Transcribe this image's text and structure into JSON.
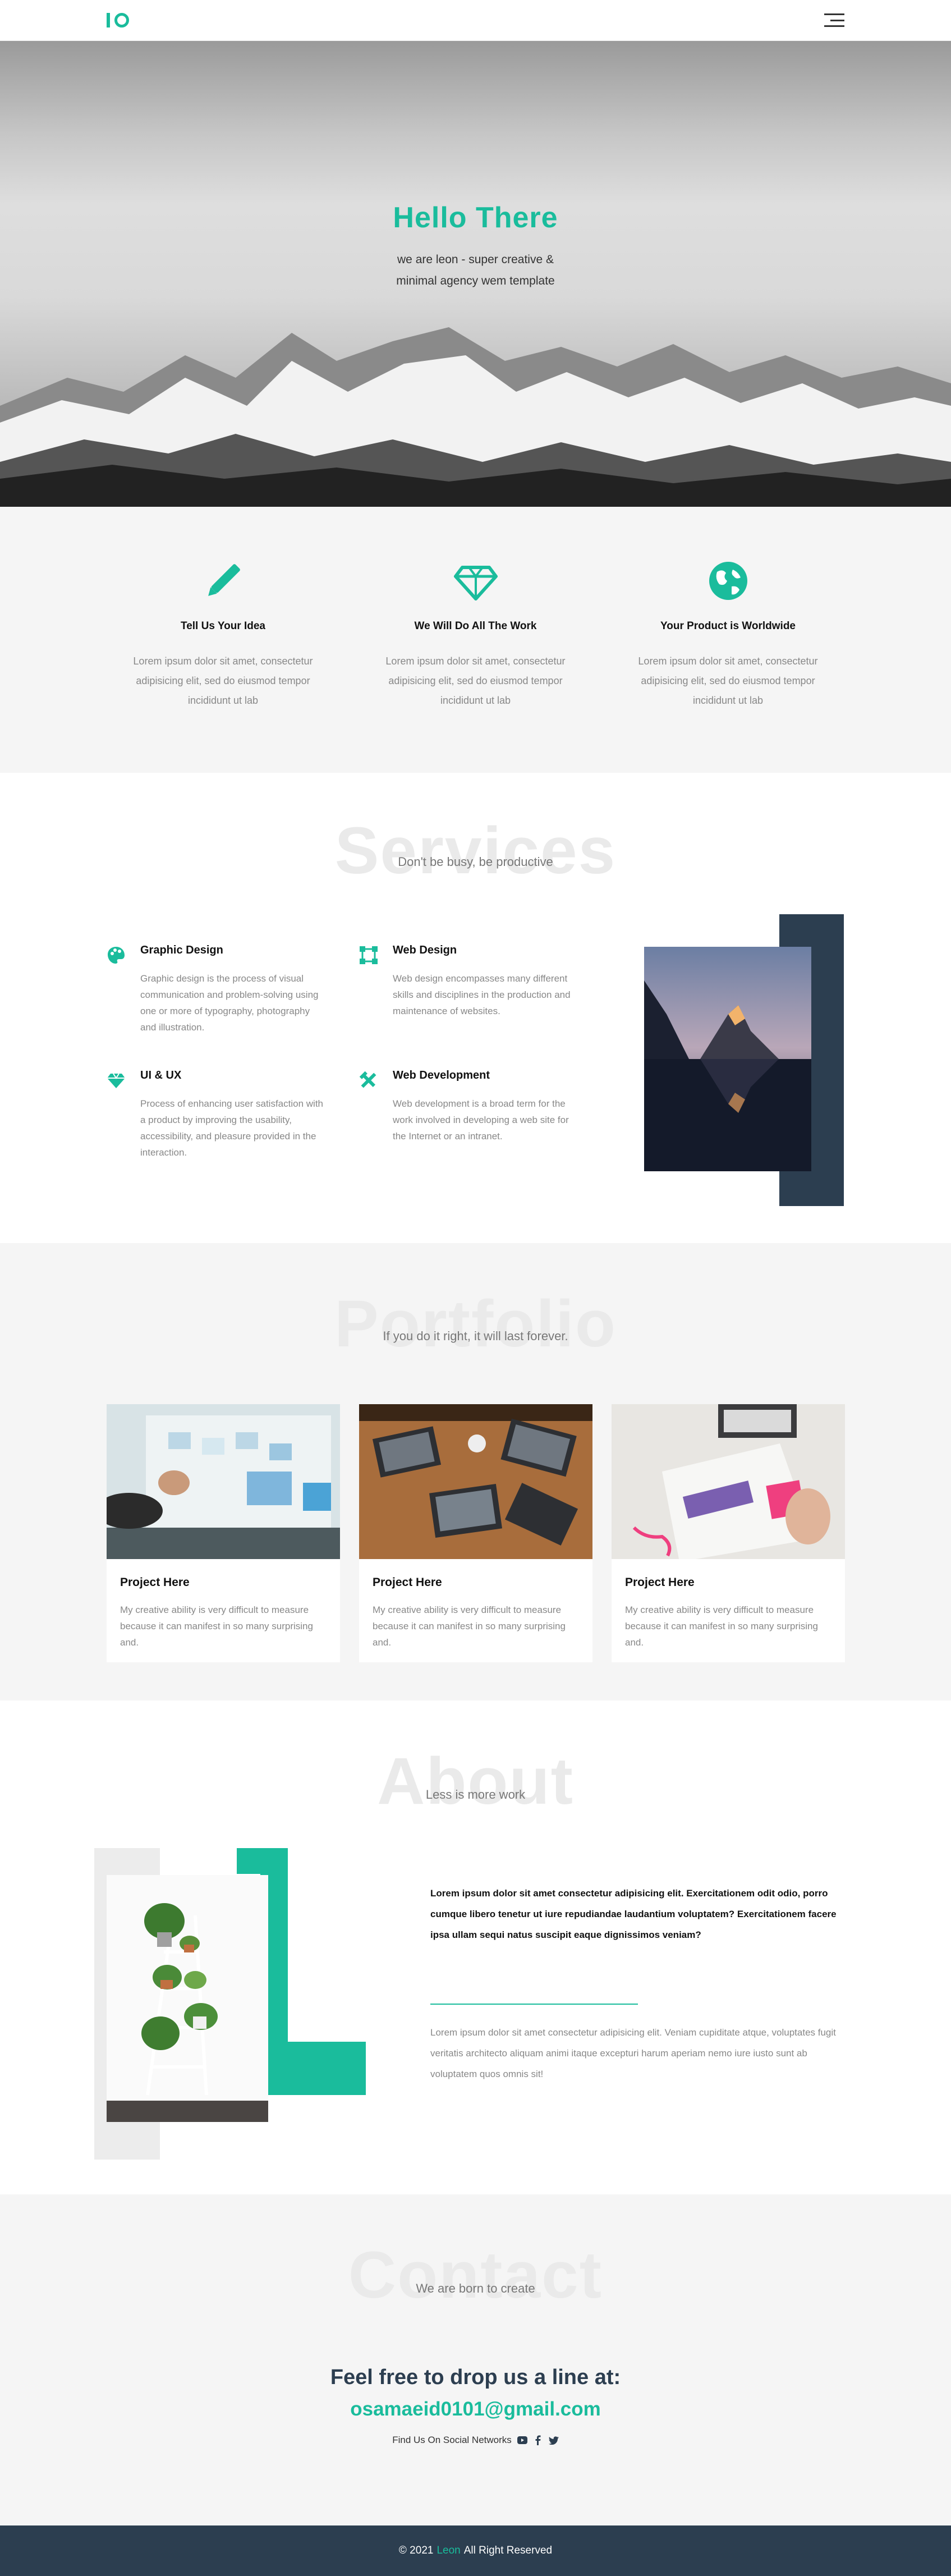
{
  "nav": {
    "logo_alt": "leon logo",
    "menu_icon": "hamburger-icon"
  },
  "hero": {
    "title": "Hello There",
    "subtitle": "we are leon - super creative & minimal agency wem template"
  },
  "features": [
    {
      "icon": "pencil-icon",
      "title": "Tell Us Your Idea",
      "text": "Lorem ipsum dolor sit amet, consectetur adipisicing elit, sed do eiusmod tempor incididunt ut lab"
    },
    {
      "icon": "diamond-icon",
      "title": "We Will Do All The Work",
      "text": "Lorem ipsum dolor sit amet, consectetur adipisicing elit, sed do eiusmod tempor incididunt ut lab"
    },
    {
      "icon": "globe-icon",
      "title": "Your Product is Worldwide",
      "text": "Lorem ipsum dolor sit amet, consectetur adipisicing elit, sed do eiusmod tempor incididunt ut lab"
    }
  ],
  "services": {
    "heading": "Services",
    "tagline": "Don't be busy, be productive",
    "items": [
      {
        "icon": "palette-icon",
        "title": "Graphic Design",
        "text": "Graphic design is the process of visual communication and problem-solving using one or more of typography, photography and illustration."
      },
      {
        "icon": "vector-square-icon",
        "title": "Web Design",
        "text": "Web design encompasses many different skills and disciplines in the production and maintenance of websites."
      },
      {
        "icon": "gem-icon",
        "title": "UI & UX",
        "text": "Process of enhancing user satisfaction with a product by improving the usability, accessibility, and pleasure provided in the interaction."
      },
      {
        "icon": "tools-icon",
        "title": "Web Development",
        "text": "Web development is a broad term for the work involved in developing a web site for the Internet or an intranet."
      }
    ]
  },
  "portfolio": {
    "heading": "Portfolio",
    "tagline": "If you do it right, it will last forever.",
    "cards": [
      {
        "title": "Project Here",
        "text": "My creative ability is very difficult to measure because it can manifest in so many surprising and."
      },
      {
        "title": "Project Here",
        "text": "My creative ability is very difficult to measure because it can manifest in so many surprising and."
      },
      {
        "title": "Project Here",
        "text": "My creative ability is very difficult to measure because it can manifest in so many surprising and."
      }
    ]
  },
  "about": {
    "heading": "About",
    "tagline": "Less is more work",
    "bold_text": "Lorem ipsum dolor sit amet consectetur adipisicing elit. Exercitationem odit odio, porro cumque libero tenetur ut iure repudiandae laudantium voluptatem? Exercitationem facere ipsa ullam sequi natus suscipit eaque dignissimos veniam?",
    "text": "Lorem ipsum dolor sit amet consectetur adipisicing elit. Veniam cupiditate atque, voluptates fugit veritatis architecto aliquam animi itaque excepturi harum aperiam nemo iure iusto sunt ab voluptatem quos omnis sit!"
  },
  "contact": {
    "heading": "Contact",
    "tagline": "We are born to create",
    "line": "Feel free to drop us a line at:",
    "email": "osamaeid0101@gmail.com",
    "social_label": "Find Us On Social Networks",
    "social_icons": [
      "youtube-icon",
      "facebook-icon",
      "twitter-icon"
    ]
  },
  "footer": {
    "prefix": "© 2021",
    "brand": "Leon",
    "suffix": "All Right Reserved"
  },
  "colors": {
    "accent": "#1abc9c",
    "dark": "#2c3e50",
    "light_bg": "#f5f5f5"
  }
}
